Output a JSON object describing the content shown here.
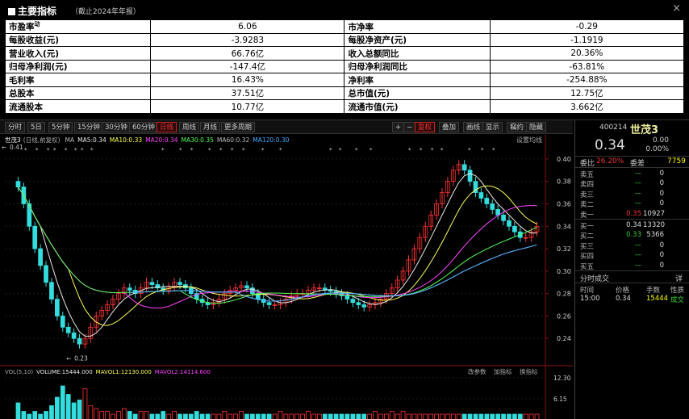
{
  "header": {
    "title": "主要指标",
    "subtitle": "（截止2024年年报）",
    "close": "×"
  },
  "indicators": [
    {
      "k1": "市盈率",
      "sup": "动",
      "v1": "6.06",
      "k2": "市净率",
      "v2": "-0.29"
    },
    {
      "k1": "每股收益(元)",
      "v1": "-3.9283",
      "k2": "每股净资产(元)",
      "v2": "-1.1919"
    },
    {
      "k1": "营业收入(元)",
      "v1": "66.76亿",
      "k2": "收入总额同比",
      "v2": "20.36%"
    },
    {
      "k1": "归母净利润(元)",
      "v1": "-147.4亿",
      "k2": "归母净利润同比",
      "v2": "-63.81%"
    },
    {
      "k1": "毛利率",
      "v1": "16.43%",
      "k2": "净利率",
      "v2": "-254.88%"
    },
    {
      "k1": "总股本",
      "v1": "37.51亿",
      "k2": "总市值(元)",
      "v2": "12.75亿"
    },
    {
      "k1": "流通股本",
      "v1": "10.77亿",
      "k2": "流通市值(元)",
      "v2": "3.662亿"
    }
  ],
  "toolbar": {
    "periods": [
      "分时",
      "5日",
      "5分钟",
      "15分钟",
      "30分钟",
      "60分钟",
      "日线",
      "周线",
      "月线",
      "更多周期"
    ],
    "active": "日线",
    "right": [
      "+",
      "−",
      "复权",
      "叠加",
      "画线",
      "显示",
      "竊约",
      "隐藏"
    ]
  },
  "chart_header": {
    "name": "世茂3",
    "mode": "(日线,前复权)",
    "ma_label": "MA",
    "ma_items": [
      {
        "text": "MA5:0.34",
        "color": "#e8e8e8"
      },
      {
        "text": "MA10:0.33",
        "color": "#ffff55"
      },
      {
        "text": "MA20:0.34",
        "color": "#ff44ff"
      },
      {
        "text": "MA30:0.35",
        "color": "#55ff55"
      },
      {
        "text": "MA60:0.32",
        "color": "#bbbbbb"
      },
      {
        "text": "MA120:0.30",
        "color": "#44aaff"
      }
    ],
    "settings": "设置均线"
  },
  "vol_header": {
    "label": "VOL(5,10)",
    "items": [
      {
        "text": "VOLUME:15444.000",
        "color": "#e8e8e8"
      },
      {
        "text": "MAVOL1:12130.000",
        "color": "#ffff55"
      },
      {
        "text": "MAVOL2:14114.600",
        "color": "#ff44ff"
      }
    ],
    "buttons": [
      "改参数",
      "加指标",
      "换指标"
    ]
  },
  "chart_data": {
    "type": "candlestick",
    "price_axis": {
      "min": 0.22,
      "max": 0.41,
      "ticks": [
        "0.40",
        "0.38",
        "0.36",
        "0.34",
        "0.32",
        "0.30",
        "0.28",
        "0.26",
        "0.24"
      ]
    },
    "volume_axis": {
      "ticks": [
        "12.30",
        "6.15"
      ],
      "unit": "万"
    },
    "high_label": "0.41",
    "low_label": "0.23",
    "closes": [
      0.375,
      0.36,
      0.34,
      0.32,
      0.305,
      0.29,
      0.275,
      0.26,
      0.25,
      0.245,
      0.24,
      0.235,
      0.24,
      0.25,
      0.26,
      0.265,
      0.27,
      0.275,
      0.28,
      0.285,
      0.283,
      0.28,
      0.285,
      0.29,
      0.288,
      0.285,
      0.283,
      0.286,
      0.29,
      0.288,
      0.285,
      0.28,
      0.275,
      0.272,
      0.27,
      0.272,
      0.275,
      0.28,
      0.283,
      0.285,
      0.287,
      0.285,
      0.28,
      0.275,
      0.272,
      0.27,
      0.27,
      0.272,
      0.275,
      0.278,
      0.28,
      0.28,
      0.283,
      0.285,
      0.285,
      0.283,
      0.282,
      0.28,
      0.278,
      0.275,
      0.272,
      0.27,
      0.268,
      0.27,
      0.272,
      0.275,
      0.28,
      0.285,
      0.292,
      0.3,
      0.31,
      0.32,
      0.33,
      0.34,
      0.35,
      0.36,
      0.37,
      0.38,
      0.39,
      0.395,
      0.39,
      0.38,
      0.37,
      0.365,
      0.36,
      0.355,
      0.35,
      0.345,
      0.34,
      0.335,
      0.33,
      0.33,
      0.335,
      0.34
    ],
    "volumes": [
      6,
      3,
      2,
      3,
      2,
      3,
      5,
      8,
      12,
      9,
      6,
      7,
      11,
      5,
      4,
      3,
      3,
      2,
      3,
      4,
      3,
      2,
      3,
      3,
      2,
      2,
      3,
      2,
      3,
      2,
      2,
      2,
      3,
      2,
      2,
      2,
      2,
      3,
      2,
      2,
      3,
      2,
      2,
      2,
      2,
      2,
      2,
      3,
      2,
      2,
      2,
      2,
      3,
      2,
      2,
      2,
      2,
      2,
      2,
      2,
      2,
      2,
      2,
      2,
      3,
      2,
      2,
      3,
      2,
      3,
      2,
      2,
      2,
      2,
      2,
      2,
      2,
      2,
      2,
      2,
      2,
      2,
      2,
      2,
      2,
      2,
      2,
      2,
      2,
      2,
      2,
      2,
      2,
      2
    ],
    "ma_series": [
      {
        "name": "MA5",
        "color": "#e8e8e8"
      },
      {
        "name": "MA10",
        "color": "#ffff55"
      },
      {
        "name": "MA20",
        "color": "#ff44ff"
      },
      {
        "name": "MA30",
        "color": "#55ff55"
      },
      {
        "name": "MA60",
        "color": "#bbbbbb"
      },
      {
        "name": "MA120",
        "color": "#44aaff"
      }
    ]
  },
  "quote": {
    "code": "400214",
    "name": "世茂3",
    "price": "0.34",
    "change": "0.00",
    "change_pct": "0.00%",
    "webi_label": "委比",
    "webi": "26.20%",
    "weicha_label": "委差",
    "weicha": "7759",
    "asks": [
      {
        "label": "卖五",
        "price": "—",
        "vol": "0"
      },
      {
        "label": "卖四",
        "price": "—",
        "vol": "0"
      },
      {
        "label": "卖三",
        "price": "—",
        "vol": "0"
      },
      {
        "label": "卖二",
        "price": "—",
        "vol": "0"
      },
      {
        "label": "卖一",
        "price": "0.35",
        "vol": "10927",
        "color": "#e33"
      }
    ],
    "bids": [
      {
        "label": "买一",
        "price": "0.34",
        "vol": "13320",
        "color": "#ddd"
      },
      {
        "label": "买二",
        "price": "0.33",
        "vol": "5366",
        "color": "#3c3"
      },
      {
        "label": "买三",
        "price": "—",
        "vol": "0"
      },
      {
        "label": "买四",
        "price": "—",
        "vol": "0"
      },
      {
        "label": "买五",
        "price": "—",
        "vol": "0"
      }
    ],
    "trades_title": "分时成交",
    "trades_tag": "详",
    "trade_cols": [
      "时间",
      "价格",
      "手数",
      "性质"
    ],
    "trades": [
      {
        "time": "15:00",
        "price": "0.34",
        "vol": "15444",
        "type": "成交"
      }
    ]
  },
  "colors": {
    "up": "#ff3333",
    "down": "#33dddd",
    "axis": "#8b1111",
    "grid": "#333333"
  }
}
